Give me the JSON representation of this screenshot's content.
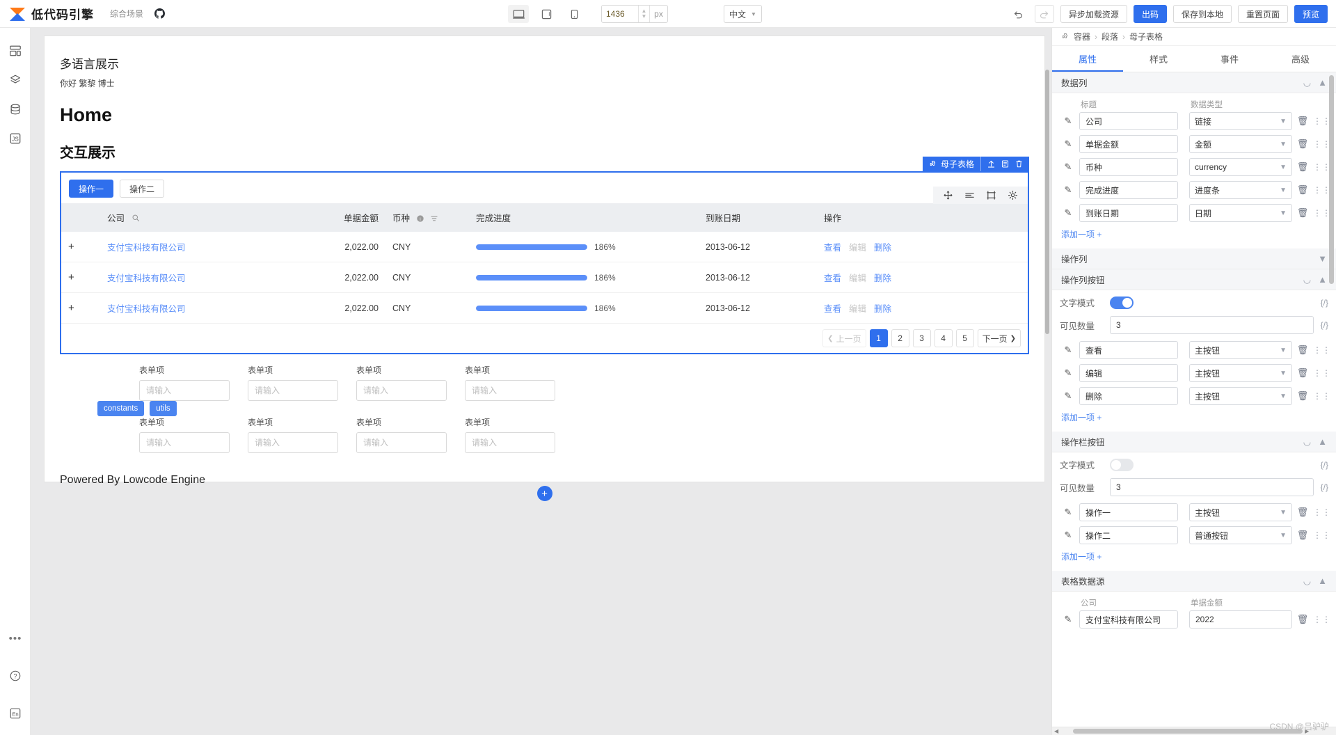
{
  "topbar": {
    "brand_name": "低代码引擎",
    "brand_sub": "综合场景",
    "github_icon": "github-icon",
    "devices": [
      {
        "name": "desktop-icon",
        "active": true
      },
      {
        "name": "tablet-icon",
        "active": false
      },
      {
        "name": "mobile-icon",
        "active": false
      }
    ],
    "size_value": "1436",
    "size_unit": "px",
    "language": "中文",
    "undo_icon": "undo-icon",
    "redo_icon": "redo-icon",
    "async_resource": "异步加载资源",
    "export": "出码",
    "save_local": "保存到本地",
    "reset_page": "重置页面",
    "preview": "预览"
  },
  "leftrail": {
    "items": [
      {
        "name": "component-library-icon"
      },
      {
        "name": "outline-tree-icon"
      },
      {
        "name": "datasource-icon"
      },
      {
        "name": "js-code-icon"
      }
    ],
    "bottom": [
      {
        "name": "more-icon",
        "glyph": "•••"
      },
      {
        "name": "help-icon",
        "glyph": "?"
      },
      {
        "name": "locale-icon",
        "glyph": "En"
      }
    ]
  },
  "canvas": {
    "title": "多语言展示",
    "greeting": "你好 繁黎 博士",
    "heading": "Home",
    "subheading": "交互展示",
    "component_badge": {
      "label": "母子表格",
      "puzzle_icon": "puzzle-icon",
      "up_icon": "select-parent-icon",
      "copy_icon": "copy-icon",
      "delete_icon": "delete-icon"
    },
    "inner_toolbar": [
      {
        "name": "move-icon"
      },
      {
        "name": "rows-icon"
      },
      {
        "name": "frame-icon"
      },
      {
        "name": "settings-icon"
      }
    ],
    "action_buttons": [
      {
        "label": "操作一",
        "type": "primary"
      },
      {
        "label": "操作二",
        "type": "normal"
      }
    ],
    "table": {
      "columns": [
        {
          "label": "",
          "key": "expander"
        },
        {
          "label": "公司",
          "key": "company",
          "icon": "search-icon"
        },
        {
          "label": "单据金额",
          "key": "amount"
        },
        {
          "label": "币种",
          "key": "currency",
          "icon": "info-icon",
          "icon2": "filter-icon"
        },
        {
          "label": "完成进度",
          "key": "progress"
        },
        {
          "label": "到账日期",
          "key": "date"
        },
        {
          "label": "操作",
          "key": "actions"
        }
      ],
      "rows": [
        {
          "expander": "+",
          "company": "支付宝科技有限公司",
          "amount": "2,022.00",
          "currency": "CNY",
          "progress_pct": "186%",
          "progress_value": 186,
          "date": "2013-06-12",
          "actions": [
            "查看",
            "编辑",
            "删除"
          ]
        },
        {
          "expander": "+",
          "company": "支付宝科技有限公司",
          "amount": "2,022.00",
          "currency": "CNY",
          "progress_pct": "186%",
          "progress_value": 186,
          "date": "2013-06-12",
          "actions": [
            "查看",
            "编辑",
            "删除"
          ]
        },
        {
          "expander": "+",
          "company": "支付宝科技有限公司",
          "amount": "2,022.00",
          "currency": "CNY",
          "progress_pct": "186%",
          "progress_value": 186,
          "date": "2013-06-12",
          "actions": [
            "查看",
            "编辑",
            "删除"
          ]
        }
      ],
      "pagination": {
        "prev": "上一页",
        "next": "下一页",
        "pages": [
          "1",
          "2",
          "3",
          "4",
          "5"
        ],
        "current": "1"
      }
    },
    "chips": [
      {
        "label": "constants"
      },
      {
        "label": "utils"
      }
    ],
    "form": {
      "label": "表单项",
      "placeholder": "请输入",
      "fields": [
        {
          "label": "表单项",
          "value": "",
          "placeholder": "请输入"
        },
        {
          "label": "表单项",
          "value": "",
          "placeholder": "请输入"
        },
        {
          "label": "表单项",
          "value": "",
          "placeholder": "请输入"
        },
        {
          "label": "表单项",
          "value": "",
          "placeholder": "请输入"
        },
        {
          "label": "表单项",
          "value": "",
          "placeholder": "请输入"
        },
        {
          "label": "表单项",
          "value": "",
          "placeholder": "请输入"
        },
        {
          "label": "表单项",
          "value": "",
          "placeholder": "请输入"
        },
        {
          "label": "表单项",
          "value": "",
          "placeholder": "请输入"
        }
      ]
    },
    "footer": "Powered By Lowcode Engine",
    "add_button": "+"
  },
  "rightpanel": {
    "breadcrumb": [
      "容器",
      "段落",
      "母子表格"
    ],
    "tabs": [
      {
        "label": "属性",
        "active": true
      },
      {
        "label": "样式",
        "active": false
      },
      {
        "label": "事件",
        "active": false
      },
      {
        "label": "高级",
        "active": false
      }
    ],
    "sections": [
      {
        "title": "数据列",
        "collapsed": false,
        "col_headers": [
          "标题",
          "数据类型"
        ],
        "rows": [
          {
            "title": "公司",
            "type": "链接"
          },
          {
            "title": "单据金额",
            "type": "金额"
          },
          {
            "title": "币种",
            "type": "currency"
          },
          {
            "title": "完成进度",
            "type": "进度条"
          },
          {
            "title": "到账日期",
            "type": "日期"
          }
        ],
        "add_label": "添加一项 +"
      },
      {
        "title": "操作列",
        "collapsed": true
      },
      {
        "title": "操作列按钮",
        "collapsed": false,
        "text_mode_label": "文字模式",
        "text_mode_on": true,
        "visible_count_label": "可见数量",
        "visible_count": "3",
        "rows": [
          {
            "title": "查看",
            "type": "主按钮"
          },
          {
            "title": "编辑",
            "type": "主按钮"
          },
          {
            "title": "删除",
            "type": "主按钮"
          }
        ],
        "add_label": "添加一项 +"
      },
      {
        "title": "操作栏按钮",
        "collapsed": false,
        "text_mode_label": "文字模式",
        "text_mode_on": false,
        "visible_count_label": "可见数量",
        "visible_count": "3",
        "rows": [
          {
            "title": "操作一",
            "type": "主按钮"
          },
          {
            "title": "操作二",
            "type": "普通按钮"
          }
        ],
        "add_label": "添加一项 +"
      },
      {
        "title": "表格数据源",
        "collapsed": false,
        "col_headers": [
          "公司",
          "单据金额"
        ],
        "rows": [
          {
            "title": "支付宝科技有限公司",
            "type": "2022"
          }
        ]
      }
    ]
  },
  "watermark": "CSDN @吕驴驴"
}
